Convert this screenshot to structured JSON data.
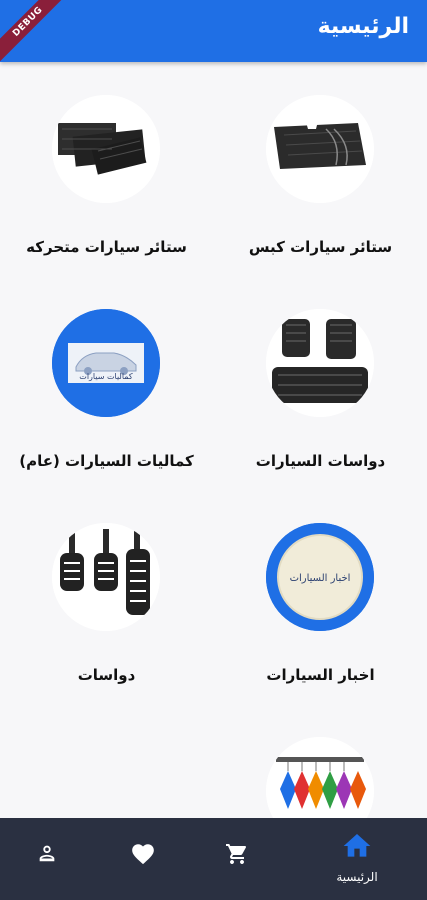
{
  "app_bar": {
    "title": "الرئيسية",
    "debug_label": "DEBUG"
  },
  "categories": [
    {
      "label": "ستائر سيارات كبس",
      "image": "black-car-sunshade-panel"
    },
    {
      "label": "ستائر سيارات متحركه",
      "image": "black-retractable-car-shades"
    },
    {
      "label": "دواسات السيارات",
      "image": "black-car-floor-mats"
    },
    {
      "label": "كماليات السيارات (عام)",
      "image": "car-accessories-logo",
      "logo_text": "كماليات سيارات"
    },
    {
      "label": "اخبار السيارات",
      "image": "car-news-logo",
      "logo_text": "اخبار السيارات"
    },
    {
      "label": "دواسات",
      "image": "car-pedals"
    },
    {
      "label": "",
      "image": "car-air-fresheners"
    }
  ],
  "bottom_nav": {
    "items": [
      {
        "label": "الرئيسية",
        "icon": "home-icon",
        "active": true
      },
      {
        "label": "",
        "icon": "cart-icon"
      },
      {
        "label": "",
        "icon": "heart-icon"
      },
      {
        "label": "",
        "icon": "person-icon"
      }
    ]
  },
  "colors": {
    "primary": "#1f6fe5",
    "nav_bg": "#2a3041",
    "debug": "#8a1f3a"
  }
}
